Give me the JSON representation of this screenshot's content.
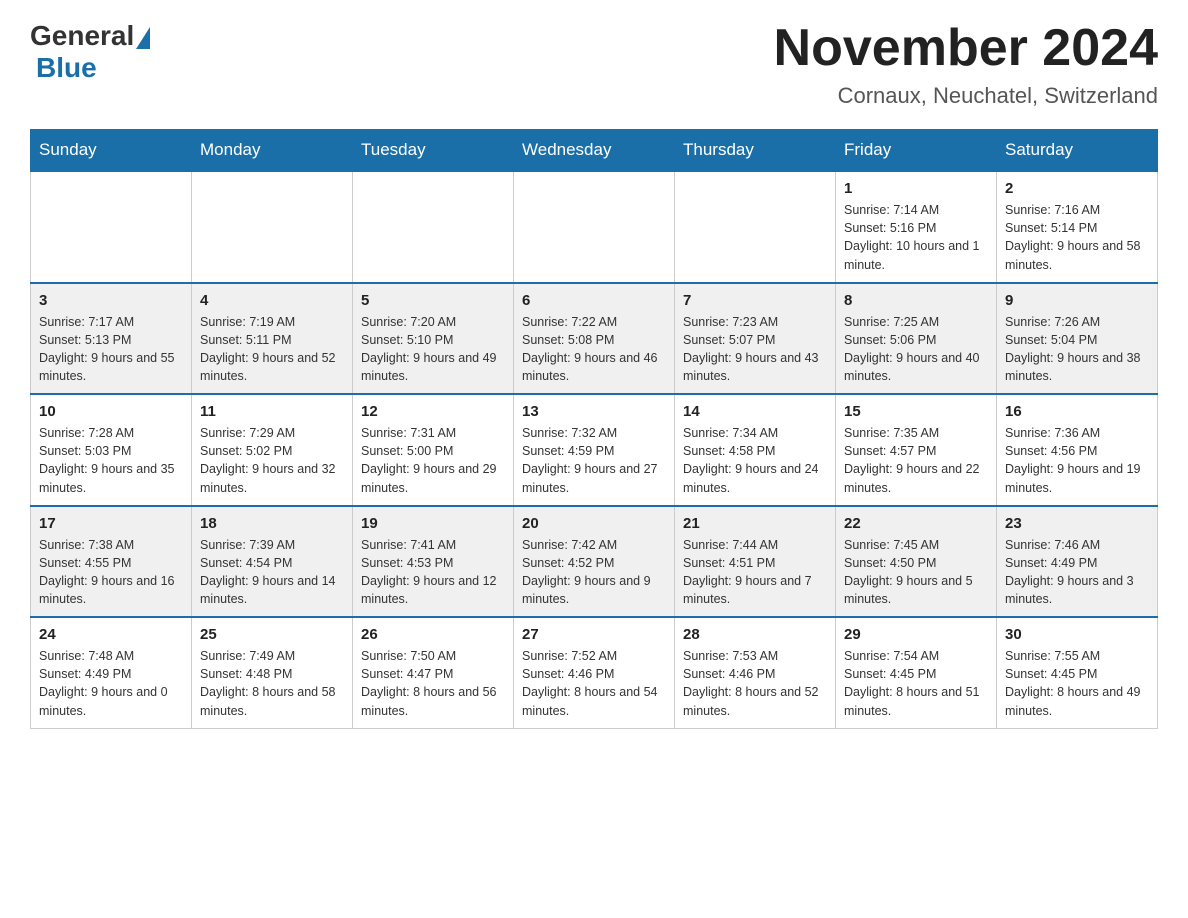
{
  "header": {
    "logo": {
      "general": "General",
      "blue": "Blue"
    },
    "title": "November 2024",
    "location": "Cornaux, Neuchatel, Switzerland"
  },
  "weekdays": [
    "Sunday",
    "Monday",
    "Tuesday",
    "Wednesday",
    "Thursday",
    "Friday",
    "Saturday"
  ],
  "weeks": [
    {
      "days": [
        {
          "number": "",
          "info": ""
        },
        {
          "number": "",
          "info": ""
        },
        {
          "number": "",
          "info": ""
        },
        {
          "number": "",
          "info": ""
        },
        {
          "number": "",
          "info": ""
        },
        {
          "number": "1",
          "info": "Sunrise: 7:14 AM\nSunset: 5:16 PM\nDaylight: 10 hours and 1 minute."
        },
        {
          "number": "2",
          "info": "Sunrise: 7:16 AM\nSunset: 5:14 PM\nDaylight: 9 hours and 58 minutes."
        }
      ]
    },
    {
      "days": [
        {
          "number": "3",
          "info": "Sunrise: 7:17 AM\nSunset: 5:13 PM\nDaylight: 9 hours and 55 minutes."
        },
        {
          "number": "4",
          "info": "Sunrise: 7:19 AM\nSunset: 5:11 PM\nDaylight: 9 hours and 52 minutes."
        },
        {
          "number": "5",
          "info": "Sunrise: 7:20 AM\nSunset: 5:10 PM\nDaylight: 9 hours and 49 minutes."
        },
        {
          "number": "6",
          "info": "Sunrise: 7:22 AM\nSunset: 5:08 PM\nDaylight: 9 hours and 46 minutes."
        },
        {
          "number": "7",
          "info": "Sunrise: 7:23 AM\nSunset: 5:07 PM\nDaylight: 9 hours and 43 minutes."
        },
        {
          "number": "8",
          "info": "Sunrise: 7:25 AM\nSunset: 5:06 PM\nDaylight: 9 hours and 40 minutes."
        },
        {
          "number": "9",
          "info": "Sunrise: 7:26 AM\nSunset: 5:04 PM\nDaylight: 9 hours and 38 minutes."
        }
      ]
    },
    {
      "days": [
        {
          "number": "10",
          "info": "Sunrise: 7:28 AM\nSunset: 5:03 PM\nDaylight: 9 hours and 35 minutes."
        },
        {
          "number": "11",
          "info": "Sunrise: 7:29 AM\nSunset: 5:02 PM\nDaylight: 9 hours and 32 minutes."
        },
        {
          "number": "12",
          "info": "Sunrise: 7:31 AM\nSunset: 5:00 PM\nDaylight: 9 hours and 29 minutes."
        },
        {
          "number": "13",
          "info": "Sunrise: 7:32 AM\nSunset: 4:59 PM\nDaylight: 9 hours and 27 minutes."
        },
        {
          "number": "14",
          "info": "Sunrise: 7:34 AM\nSunset: 4:58 PM\nDaylight: 9 hours and 24 minutes."
        },
        {
          "number": "15",
          "info": "Sunrise: 7:35 AM\nSunset: 4:57 PM\nDaylight: 9 hours and 22 minutes."
        },
        {
          "number": "16",
          "info": "Sunrise: 7:36 AM\nSunset: 4:56 PM\nDaylight: 9 hours and 19 minutes."
        }
      ]
    },
    {
      "days": [
        {
          "number": "17",
          "info": "Sunrise: 7:38 AM\nSunset: 4:55 PM\nDaylight: 9 hours and 16 minutes."
        },
        {
          "number": "18",
          "info": "Sunrise: 7:39 AM\nSunset: 4:54 PM\nDaylight: 9 hours and 14 minutes."
        },
        {
          "number": "19",
          "info": "Sunrise: 7:41 AM\nSunset: 4:53 PM\nDaylight: 9 hours and 12 minutes."
        },
        {
          "number": "20",
          "info": "Sunrise: 7:42 AM\nSunset: 4:52 PM\nDaylight: 9 hours and 9 minutes."
        },
        {
          "number": "21",
          "info": "Sunrise: 7:44 AM\nSunset: 4:51 PM\nDaylight: 9 hours and 7 minutes."
        },
        {
          "number": "22",
          "info": "Sunrise: 7:45 AM\nSunset: 4:50 PM\nDaylight: 9 hours and 5 minutes."
        },
        {
          "number": "23",
          "info": "Sunrise: 7:46 AM\nSunset: 4:49 PM\nDaylight: 9 hours and 3 minutes."
        }
      ]
    },
    {
      "days": [
        {
          "number": "24",
          "info": "Sunrise: 7:48 AM\nSunset: 4:49 PM\nDaylight: 9 hours and 0 minutes."
        },
        {
          "number": "25",
          "info": "Sunrise: 7:49 AM\nSunset: 4:48 PM\nDaylight: 8 hours and 58 minutes."
        },
        {
          "number": "26",
          "info": "Sunrise: 7:50 AM\nSunset: 4:47 PM\nDaylight: 8 hours and 56 minutes."
        },
        {
          "number": "27",
          "info": "Sunrise: 7:52 AM\nSunset: 4:46 PM\nDaylight: 8 hours and 54 minutes."
        },
        {
          "number": "28",
          "info": "Sunrise: 7:53 AM\nSunset: 4:46 PM\nDaylight: 8 hours and 52 minutes."
        },
        {
          "number": "29",
          "info": "Sunrise: 7:54 AM\nSunset: 4:45 PM\nDaylight: 8 hours and 51 minutes."
        },
        {
          "number": "30",
          "info": "Sunrise: 7:55 AM\nSunset: 4:45 PM\nDaylight: 8 hours and 49 minutes."
        }
      ]
    }
  ]
}
